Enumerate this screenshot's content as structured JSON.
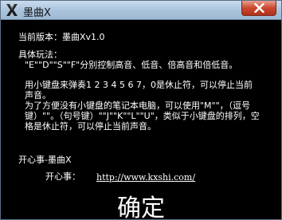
{
  "window": {
    "title": "墨曲X"
  },
  "about": {
    "version": "当前版本：墨曲Xv1.0",
    "gameplay_heading": "具体玩法：",
    "gameplay_line1": "\"E\"\"D\"\"S\"\"F\"分别控制高音、低音、倍高音和倍低音。",
    "gameplay_line2": "用小键盘来弹奏1 2 3 4 5 6 7，0是休止符，可以停止当前声音。",
    "gameplay_line3": "为了方便没有小键盘的笔记本电脑，可以使用\"M\"\"，（逗号键）\"\"。（句号键）\"\"J\"\"K\"\"L\"\"U\"，类似于小键盘的排列，空格是休止符，可以停止当前声音。",
    "credit_line": "开心事-墨曲X",
    "site_label": "开心事：",
    "site_url": "http://www.kxshi.com/"
  },
  "buttons": {
    "confirm_label": "确定"
  },
  "icons": {
    "app": "moqu-x-logo-icon",
    "close": "close-icon"
  },
  "colors": {
    "background": "#000000",
    "text": "#ffffff",
    "titlebar": "#a9c3dc",
    "close_button": "#c9482f"
  }
}
